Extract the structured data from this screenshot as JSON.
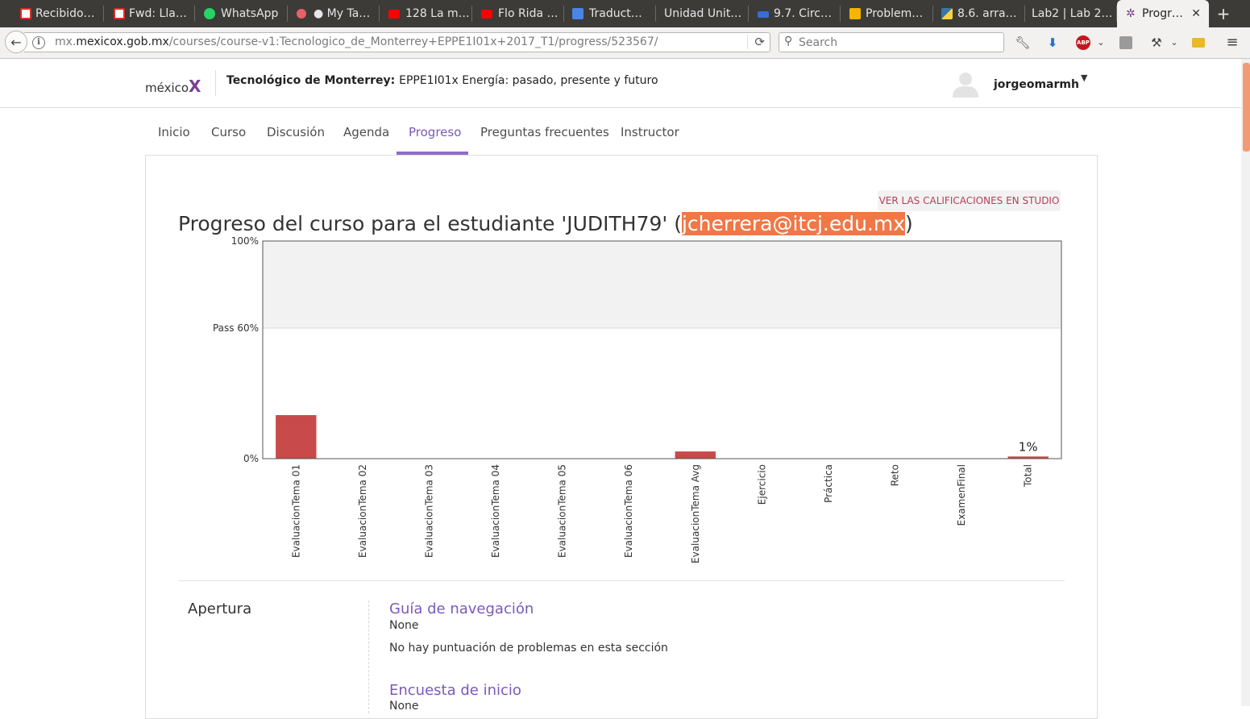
{
  "browser": {
    "tabs": [
      {
        "label": "Recibido…",
        "icon": "gmail-icon",
        "color": "#d93025"
      },
      {
        "label": "Fwd: Lla…",
        "icon": "gmail-icon",
        "color": "#d93025"
      },
      {
        "label": "WhatsApp",
        "icon": "whatsapp-icon",
        "color": "#25d366"
      },
      {
        "label": "● My Ta…",
        "icon": "asana-icon",
        "color": "#e8606a"
      },
      {
        "label": "128 La m…",
        "icon": "youtube-icon",
        "color": "#ff0000"
      },
      {
        "label": "Flo Rida …",
        "icon": "youtube-icon",
        "color": "#ff0000"
      },
      {
        "label": "Traduct…",
        "icon": "google-translate-icon",
        "color": "#4a86e8"
      },
      {
        "label": "Unidad Unit…",
        "icon": "",
        "color": ""
      },
      {
        "label": "9.7. Circ…",
        "icon": "edx-icon",
        "color": "#3b6bd6"
      },
      {
        "label": "Problem…",
        "icon": "slides-icon",
        "color": "#f4b400"
      },
      {
        "label": "8.6. arra…",
        "icon": "python-icon",
        "color": "#3776ab"
      },
      {
        "label": "Lab2 | Lab 2…",
        "icon": "",
        "color": ""
      },
      {
        "label": "Progr…",
        "icon": "mexicox-icon",
        "color": "#7b3f91"
      }
    ],
    "url_prefix": "mx.",
    "url_domain": "mexicox.gob.mx",
    "url_path": "/courses/course-v1:Tecnologico_de_Monterrey+EPPE1I01x+2017_T1/progress/523567/",
    "search_placeholder": "Search",
    "new_tab_label": "+",
    "toolbar_icons": [
      "wrench-icon",
      "download-icon",
      "adblock-icon",
      "reader-icon",
      "tools-icon",
      "bookmark-icon",
      "menu-icon"
    ],
    "adblock_label": "ABP"
  },
  "header": {
    "logo_text": "méxico",
    "logo_x": "X",
    "course_org": "Tecnológico de Monterrey:",
    "course_name": "EPPE1I01x Energía: pasado, presente y futuro",
    "username": "jorgeomarmh"
  },
  "course_tabs": [
    "Inicio",
    "Curso",
    "Discusión",
    "Agenda",
    "Progreso",
    "Preguntas frecuentes",
    "Instructor"
  ],
  "active_tab": "Progreso",
  "studio_button": "VER LAS CALIFICACIONES EN STUDIO",
  "progress": {
    "title_prefix": "Progreso del curso para el estudiante 'JUDITH79' (",
    "email": "jcherrera@itcj.edu.mx",
    "title_suffix": ")"
  },
  "chart_data": {
    "type": "bar",
    "categories": [
      "EvaluacionTema 01",
      "EvaluacionTema 02",
      "EvaluacionTema 03",
      "EvaluacionTema 04",
      "EvaluacionTema 05",
      "EvaluacionTema 06",
      "EvaluacionTema Avg",
      "Ejercicio",
      "Práctica",
      "Reto",
      "ExamenFinal",
      "Total"
    ],
    "values": [
      20,
      0,
      0,
      0,
      0,
      0,
      3.3,
      0,
      0,
      0,
      0,
      1
    ],
    "ylim": [
      0,
      100
    ],
    "yticks": [
      {
        "value": 0,
        "label": "0%"
      },
      {
        "value": 60,
        "label": "Pass 60%"
      },
      {
        "value": 100,
        "label": "100%"
      }
    ],
    "pass_value": 60,
    "total_label": "1%",
    "bar_color": "#c94a4a",
    "pass_zone_color": "#f2f2f2",
    "title": "",
    "xlabel": "",
    "ylabel": ""
  },
  "sections": {
    "chapter": "Apertura",
    "items": [
      {
        "title": "Guía de navegación",
        "score": "None",
        "note": "No hay puntuación de problemas en esta sección"
      },
      {
        "title": "Encuesta de inicio",
        "score": "None",
        "note": ""
      }
    ]
  },
  "colors": {
    "accent": "#7b59b8",
    "highlight": "#f07746",
    "studio_text": "#b43f5a"
  }
}
